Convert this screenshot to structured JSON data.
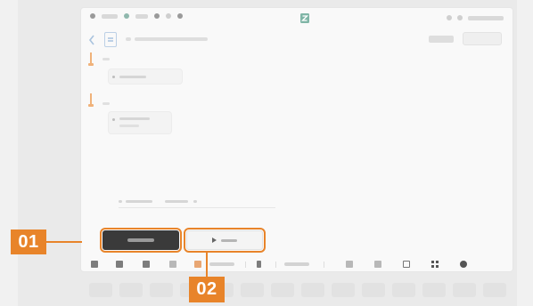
{
  "status_bar": {
    "time": "",
    "indicators": [
      "",
      ""
    ],
    "right_text": ""
  },
  "header": {
    "title": "",
    "secondary_button": "",
    "primary_button": ""
  },
  "steps": [
    {
      "marker": "",
      "card_text": ""
    },
    {
      "marker": "",
      "card_text": ""
    }
  ],
  "pill_row": {
    "labels": [
      "",
      ""
    ]
  },
  "actions": {
    "save_label": "",
    "run_label": "",
    "run_icon": "play-icon"
  },
  "toolbar": {
    "items": [
      "grid-icon",
      "image-icon",
      "layers-icon",
      "table-icon",
      "chart-icon",
      "text",
      "pin-icon",
      "text",
      "link-icon",
      "doc-icon",
      "shape-icon",
      "grid-icon",
      "settings-icon"
    ]
  },
  "callouts": {
    "first": "01",
    "second": "02"
  },
  "colors": {
    "accent": "#e8842a",
    "save_button": "#3a3a3a",
    "step_marker": "#f0b27a"
  }
}
